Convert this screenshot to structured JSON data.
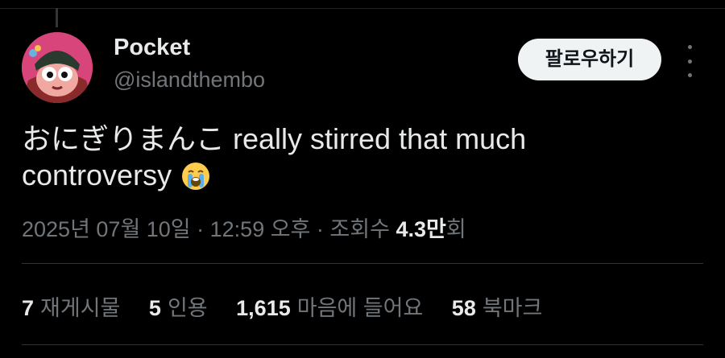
{
  "author": {
    "name": "Pocket",
    "handle": "@islandthembo",
    "avatar_icon": "pink-character-avatar"
  },
  "header": {
    "follow_label": "팔로우하기",
    "more_icon": "more-dots-icon"
  },
  "tweet": {
    "text_line1": "おにぎりまんこ really stirred that much",
    "text_line2": "controversy",
    "emoji": "loudly-crying-face"
  },
  "meta": {
    "datetime": "2025년 07월 10일 · 12:59 오후 · 조회수",
    "views_count": "4.3만",
    "views_suffix": "회"
  },
  "stats": {
    "reposts_count": "7",
    "reposts_label": "재게시물",
    "quotes_count": "5",
    "quotes_label": "인용",
    "likes_count": "1,615",
    "likes_label": "마음에 들어요",
    "bookmarks_count": "58",
    "bookmarks_label": "북마크"
  },
  "colors": {
    "background": "#000000",
    "primary_text": "#e7e9ea",
    "secondary_text": "#71767b",
    "follow_button_bg": "#eff3f4",
    "divider": "#2f3336"
  }
}
